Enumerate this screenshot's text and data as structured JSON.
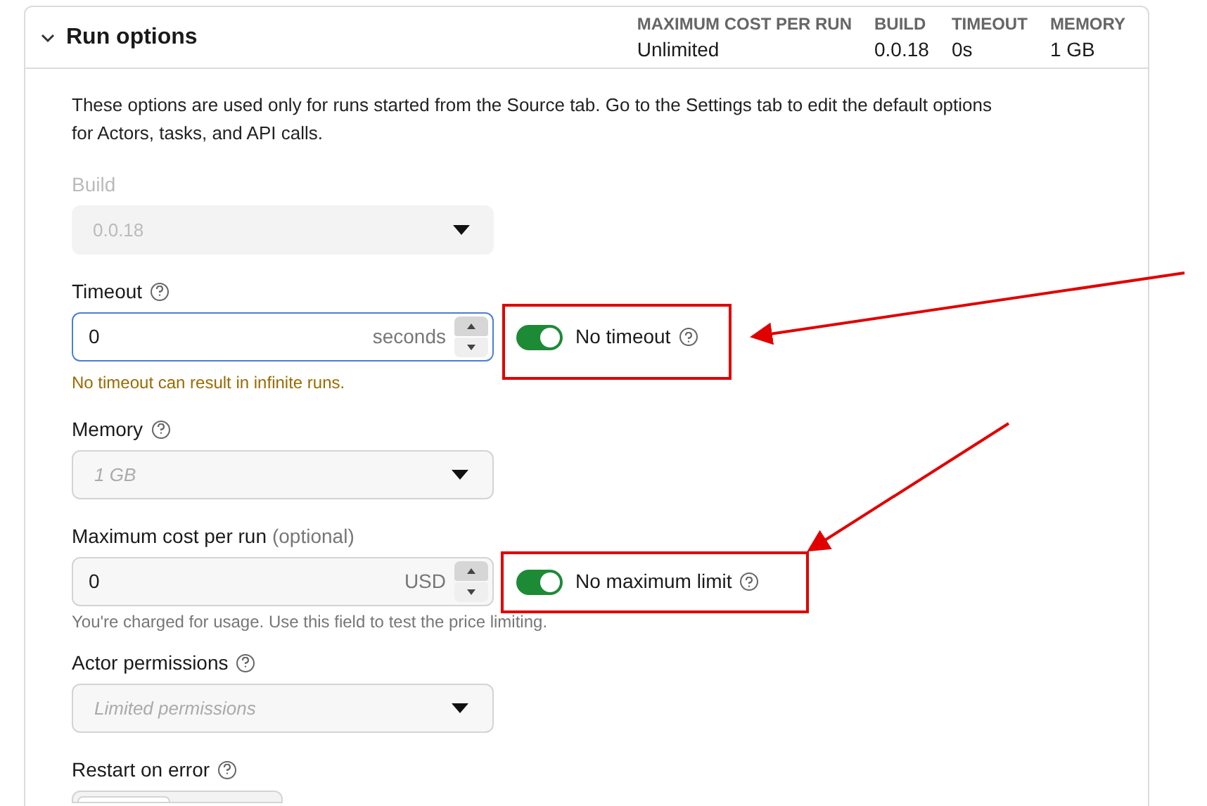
{
  "section": {
    "title": "Run options",
    "expanded": true,
    "stats": [
      {
        "label": "MAXIMUM COST PER RUN",
        "value": "Unlimited"
      },
      {
        "label": "BUILD",
        "value": "0.0.18"
      },
      {
        "label": "TIMEOUT",
        "value": "0s"
      },
      {
        "label": "MEMORY",
        "value": "1 GB"
      }
    ]
  },
  "description": "These options are used only for runs started from the Source tab. Go to the Settings tab to edit the default options for Actors, tasks, and API calls.",
  "fields": [
    {
      "kind": "select",
      "label": "Build",
      "help": false,
      "disabled": true,
      "value": "0.0.18"
    },
    {
      "kind": "number",
      "label": "Timeout",
      "help": true,
      "focused": true,
      "value": "0",
      "unit": "seconds",
      "toggle": {
        "label": "No timeout",
        "on": true,
        "help": true
      },
      "hint": {
        "text": "No timeout can result in infinite runs.",
        "kind": "warning"
      }
    },
    {
      "kind": "select",
      "label": "Memory",
      "help": true,
      "disabled": false,
      "placeholder": "1 GB"
    },
    {
      "kind": "number",
      "label": "Maximum cost per run",
      "note": "(optional)",
      "help": false,
      "focused": false,
      "value": "0",
      "unit": "USD",
      "toggle": {
        "label": "No maximum limit",
        "on": true,
        "help": true
      },
      "hint": {
        "text": "You're charged for usage. Use this field to test the price limiting.",
        "kind": "info"
      }
    },
    {
      "kind": "select",
      "label": "Actor permissions",
      "help": true,
      "disabled": false,
      "placeholder": "Limited permissions"
    },
    {
      "kind": "segmented",
      "label": "Restart on error",
      "help": true
    }
  ]
}
